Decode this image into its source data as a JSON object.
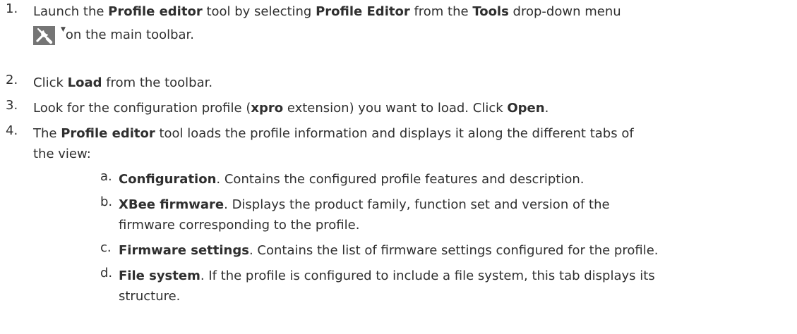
{
  "steps": [
    {
      "number": "1.",
      "t1": "Launch the ",
      "b1": "Profile editor",
      "t2": " tool by selecting ",
      "b2": "Profile Editor",
      "t3": " from the ",
      "b3": "Tools",
      "t4": " drop-down menu",
      "icon": "tools-icon",
      "t5": "on the main toolbar."
    },
    {
      "number": "2.",
      "t1": "Click ",
      "b1": "Load",
      "t2": " from the toolbar."
    },
    {
      "number": "3.",
      "t1": "Look for the configuration profile (",
      "b1": "xpro",
      "t2": " extension) you want to load. Click ",
      "b2": "Open",
      "t3": "."
    },
    {
      "number": "4.",
      "t1": "The ",
      "b1": "Profile editor",
      "t2": " tool loads the profile information and displays it along the different tabs of",
      "t3": "the view:",
      "subitems": [
        {
          "letter": "a.",
          "bold": "Configuration",
          "text": ". Contains the configured profile features and description."
        },
        {
          "letter": "b.",
          "bold": "XBee firmware",
          "text": ". Displays the product family, function set and version of the",
          "text2": "firmware corresponding to the profile."
        },
        {
          "letter": "c.",
          "bold": "Firmware settings",
          "text": ". Contains the list of firmware settings configured for the profile."
        },
        {
          "letter": "d.",
          "bold": "File system",
          "text": ". If the profile is configured to include a file system, this tab displays its",
          "text2": "structure."
        }
      ]
    }
  ]
}
